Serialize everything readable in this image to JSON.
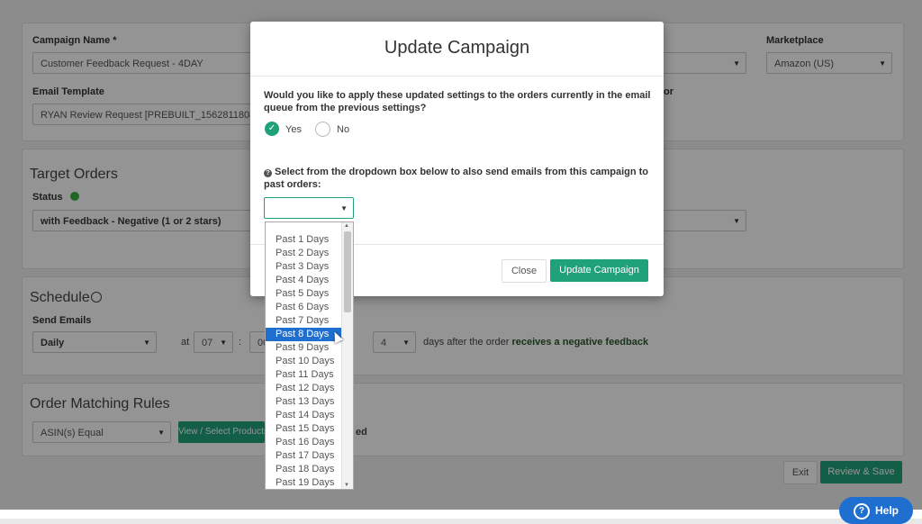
{
  "background": {
    "campaign_name_label": "Campaign Name *",
    "campaign_name_value": "Customer Feedback Request - 4DAY",
    "marketplace_label": "Marketplace",
    "marketplace_value": "Amazon (US)",
    "email_template_label": "Email Template",
    "email_template_value": "RYAN Review Request [PREBUILT_1562811808",
    "email_template_suffix": "or",
    "target_orders_title": "Target Orders",
    "status_label": "Status",
    "status_value": "with Feedback - Negative (1 or 2 stars)",
    "schedule_title": "Schedule",
    "send_emails_label": "Send Emails",
    "send_emails_value": "Daily",
    "at_label": "at",
    "hour_value": "07",
    "minute_value": "00",
    "days_value": "4",
    "days_after_text": "days after the order",
    "trigger_text": "receives a negative feedback",
    "order_matching_title": "Order Matching Rules",
    "asin_rule_value": "ASIN(s) Equal",
    "view_products_label": "View / Select Products",
    "selected_suffix": "ed",
    "exit_label": "Exit",
    "review_save_label": "Review & Save",
    "help_label": "Help"
  },
  "modal": {
    "title": "Update Campaign",
    "question1": "Would you like to apply these updated settings to the orders currently in the email queue from the previous settings?",
    "yes_label": "Yes",
    "no_label": "No",
    "question2": "Select from the dropdown box below to also send emails from this campaign to past orders:",
    "close_label": "Close",
    "update_label": "Update Campaign"
  },
  "dropdown": {
    "selected_index": 7,
    "options": [
      "Past 1 Days",
      "Past 2 Days",
      "Past 3 Days",
      "Past 4 Days",
      "Past 5 Days",
      "Past 6 Days",
      "Past 7 Days",
      "Past 8 Days",
      "Past 9 Days",
      "Past 10 Days",
      "Past 11 Days",
      "Past 12 Days",
      "Past 13 Days",
      "Past 14 Days",
      "Past 15 Days",
      "Past 16 Days",
      "Past 17 Days",
      "Past 18 Days",
      "Past 19 Days"
    ]
  },
  "colors": {
    "accent_green": "#1fa27a",
    "selection_blue": "#1e6fd0",
    "status_dot": "#3cb043"
  },
  "icons": {
    "radio_checked": "check-icon",
    "question": "question-circle-icon",
    "schedule": "clock-icon",
    "help": "question-circle-icon"
  }
}
